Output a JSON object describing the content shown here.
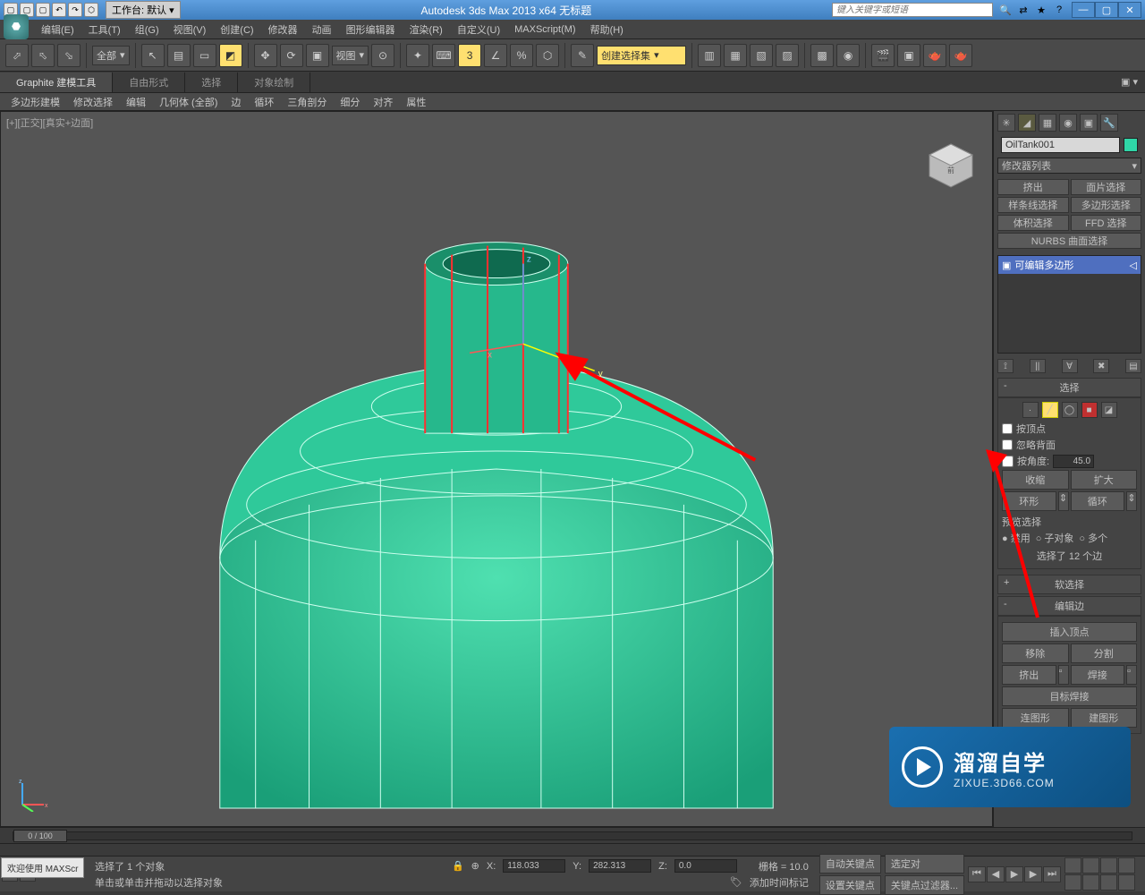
{
  "titlebar": {
    "workspace_label": "工作台: 默认",
    "app_title": "Autodesk 3ds Max  2013 x64   无标题",
    "search_placeholder": "键入关键字或短语"
  },
  "menu": {
    "edit": "编辑(E)",
    "tools": "工具(T)",
    "group": "组(G)",
    "views": "视图(V)",
    "create": "创建(C)",
    "modifiers": "修改器",
    "animation": "动画",
    "graph": "图形编辑器",
    "render": "渲染(R)",
    "customize": "自定义(U)",
    "maxscript": "MAXScript(M)",
    "help": "帮助(H)"
  },
  "toolbar": {
    "all_filter": "全部",
    "view_dropdown": "视图",
    "create_set": "创建选择集"
  },
  "ribbon": {
    "tab_graphite": "Graphite 建模工具",
    "tab_freeform": "自由形式",
    "tab_select": "选择",
    "tab_paint": "对象绘制"
  },
  "subribbon": {
    "poly_model": "多边形建模",
    "mod_select": "修改选择",
    "edit": "编辑",
    "geom_all": "几何体 (全部)",
    "edge": "边",
    "loop": "循环",
    "tri": "三角剖分",
    "subdiv": "细分",
    "align": "对齐",
    "props": "属性"
  },
  "viewport": {
    "label": "[+][正交][真实+边面]"
  },
  "cmdpanel": {
    "object_name": "OilTank001",
    "modifier_list": "修改器列表",
    "btn_extrude": "挤出",
    "btn_facesel": "面片选择",
    "btn_splinesel": "样条线选择",
    "btn_polysel": "多边形选择",
    "btn_volsel": "体积选择",
    "btn_ffdsel": "FFD 选择",
    "btn_nurbs": "NURBS 曲面选择",
    "stack_item": "可编辑多边形",
    "rollout_select": "选择",
    "chk_byvertex": "按顶点",
    "chk_ignoreback": "忽略背面",
    "chk_byangle": "按角度:",
    "angle_value": "45.0",
    "btn_shrink": "收缩",
    "btn_grow": "扩大",
    "btn_ring": "环形",
    "btn_loop": "循环",
    "preview_label": "预览选择",
    "radio_disable": "禁用",
    "radio_subobj": "子对象",
    "radio_multi": "多个",
    "selected_count": "选择了 12 个边",
    "rollout_softsel": "软选择",
    "rollout_editedge": "编辑边",
    "btn_insertvert": "插入顶点",
    "btn_remove": "移除",
    "btn_split": "分割",
    "btn_extrude2": "挤出",
    "btn_weld": "焊接",
    "btn_targetweld": "目标焊接",
    "btn_bridge": "连图形",
    "btn_createshape": "建图形"
  },
  "timeline": {
    "frame": "0 / 100"
  },
  "status": {
    "sel_info": "选择了 1 个对象",
    "prompt": "单击或单击并拖动以选择对象",
    "x_label": "X:",
    "x_val": "118.033",
    "y_label": "Y:",
    "y_val": "282.313",
    "z_label": "Z:",
    "z_val": "0.0",
    "grid": "栅格 = 10.0",
    "add_time_tag": "添加时间标记",
    "auto_key": "自动关键点",
    "set_key": "设置关键点",
    "sel_set": "选定对",
    "key_filter": "关键点过滤器..."
  },
  "welcome": "欢迎使用  MAXScr",
  "watermark": {
    "line1": "溜溜自学",
    "line2": "ZIXUE.3D66.COM"
  }
}
